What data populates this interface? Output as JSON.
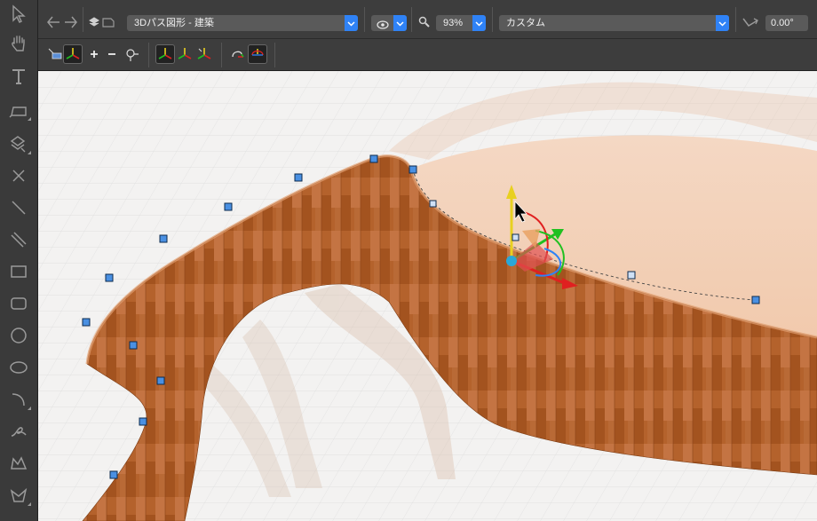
{
  "app": {
    "tools": [
      {
        "name": "select-arrow-icon"
      },
      {
        "name": "pan-hand-icon"
      },
      {
        "name": "text-tool-icon"
      },
      {
        "name": "shape-tool-icon"
      },
      {
        "name": "fill-tool-icon"
      },
      {
        "name": "x-tool-icon"
      },
      {
        "name": "line-tool-icon"
      },
      {
        "name": "double-line-tool-icon"
      },
      {
        "name": "rectangle-tool-icon"
      },
      {
        "name": "rounded-rectangle-tool-icon"
      },
      {
        "name": "circle-tool-icon"
      },
      {
        "name": "ellipse-tool-icon"
      },
      {
        "name": "arc-tool-icon"
      },
      {
        "name": "freehand-tool-icon"
      },
      {
        "name": "polyline-tool-icon"
      },
      {
        "name": "3d-shape-tool-icon"
      }
    ]
  },
  "topbar": {
    "path_mode": "3Dパス図形 - 建築",
    "zoom": "93%",
    "view_preset": "カスタム",
    "angle": "0.00°"
  },
  "subbar": {
    "buttons": [
      {
        "name": "add-object-button",
        "active": false
      },
      {
        "name": "axis-mode-button",
        "active": true
      },
      {
        "name": "add-point-button",
        "active": false
      },
      {
        "name": "remove-point-button",
        "active": false
      },
      {
        "name": "link-point-button",
        "active": false
      },
      {
        "name": "gizmo-global-button",
        "active": true
      },
      {
        "name": "gizmo-local-button",
        "active": false
      },
      {
        "name": "gizmo-view-button",
        "active": false
      },
      {
        "name": "rotate-path-button",
        "active": false
      },
      {
        "name": "rotate-alt-button",
        "active": true
      }
    ]
  },
  "colors": {
    "accent": "#2f82f6",
    "handle": "#4a90e2",
    "wood": "#b4622c",
    "x_axis": "#e02020",
    "y_axis": "#e8d020",
    "z_axis": "#20c020"
  }
}
